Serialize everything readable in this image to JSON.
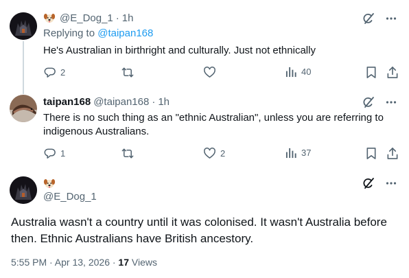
{
  "tweets": [
    {
      "author_name": "",
      "handle": "@E_Dog_1",
      "time": "1h",
      "reply_prefix": "Replying to ",
      "reply_handle": "@taipan168",
      "text": "He's Australian in birthright and culturally. Just not ethnically",
      "replies": "2",
      "retweets": "",
      "likes": "",
      "views": "40"
    },
    {
      "author_name": "taipan168",
      "handle": "@taipan168",
      "time": "1h",
      "text": "There is no such thing as an \"ethnic Australian\", unless you are referring to indigenous Australians.",
      "replies": "1",
      "retweets": "",
      "likes": "2",
      "views": "37"
    }
  ],
  "main_tweet": {
    "handle": "@E_Dog_1",
    "text": "Australia wasn't a country until it was colonised. It wasn't Australia before then. Ethnic Australians have British ancestory.",
    "timestamp": "5:55 PM · Apr 13, 2026 · ",
    "views_count": "17",
    "views_label": " Views"
  },
  "separator": "·",
  "icons": {
    "grok": "grok-slash-icon",
    "more": "more-dots-icon",
    "reply": "reply-icon",
    "retweet": "retweet-icon",
    "like": "heart-icon",
    "views": "views-bars-icon",
    "bookmark": "bookmark-icon",
    "share": "share-icon"
  },
  "colors": {
    "accent": "#1d9bf0",
    "muted": "#536471",
    "text": "#0f1419",
    "line": "#cfd9de"
  }
}
